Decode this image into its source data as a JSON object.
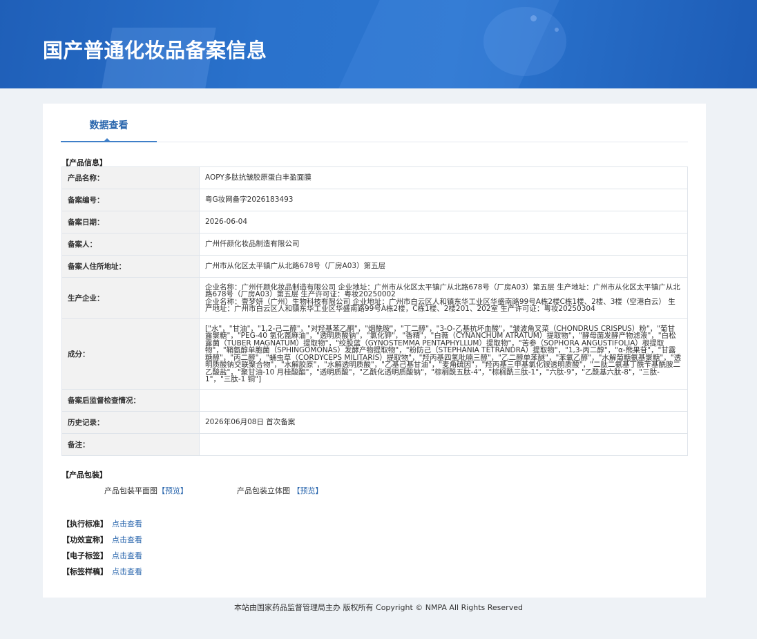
{
  "banner": {
    "title": "国产普通化妆品备案信息"
  },
  "tabs": [
    {
      "label": "数据查看"
    }
  ],
  "sections": {
    "product_info": "【产品信息】",
    "package": "【产品包装】"
  },
  "product": {
    "rows": [
      {
        "key": "产品名称：",
        "value": "AOPY多肽抗皱胶原蛋白丰盈面膜"
      },
      {
        "key": "备案编号：",
        "value": "粤G妆网备字2026183493"
      },
      {
        "key": "备案日期：",
        "value": "2026-06-04"
      },
      {
        "key": "备案人：",
        "value": "广州仟颜化妆品制造有限公司"
      },
      {
        "key": "备案人住所地址：",
        "value": "广州市从化区太平镇广从北路678号（厂房A03）第五层"
      },
      {
        "key": "生产企业：",
        "value": "企业名称：广州仟颜化妆品制造有限公司 企业地址：广州市从化区太平镇广从北路678号（厂房A03）第五层 生产地址：广州市从化区太平镇广从北路678号（厂房A03）第五层 生产许可证：粤妆20250002\n企业名称：壹梦妍（广州）生物科技有限公司 企业地址：广州市白云区人和镇东华工业区华盛南路99号A栋2楼C栋1楼、2楼、3楼（空港白云） 生产地址：广州市白云区人和镇东华工业区华盛南路99号A栋2楼，C栋1楼、2楼201、202室 生产许可证：粤妆20250304"
      },
      {
        "key": "成分：",
        "value": "[\"水\"，\"甘油\"，\"1,2-己二醇\"，\"对羟基苯乙酮\"，\"烟酰胺\"，\"丁二醇\"，\"3-O-乙基抗坏血酸\"，\"皱波角叉菜（CHONDRUS CRISPUS）粉\"，\"葡甘露聚糖\"，\"PEG-40 氢化蓖麻油\"，\"透明质酸钠\"，\"氯化钾\"，\"香精\"，\"白薇（CYNANCHUM ATRATUM）提取物\"，\"酵母菌发酵产物滤液\"，\"白松露菌（TUBER MAGNATUM）提取物\"，\"绞股蓝（GYNOSTEMMA PENTAPHYLLUM）提取物\"，\"苦参（SOPHORA ANGUSTIFOLIA）根提取物\"，\"鞘氨醇单胞菌（SPHINGOMONAS）发酵产物提取物\"，\"粉防己（STEPHANIA TETRANDRA）提取物\"，\"1,3-丙二醇\"，\"α-熊果苷\"，\"甘露糖醇\"，\"丙二醇\"，\"蛹虫草（CORDYCEPS MILITARIS）提取物\"，\"羟丙基四氢吡喃三醇\"，\"乙二醇单苯醚\"，\"苯氧乙醇\"，\"水解葡糖氨基聚糖\"，\"透明质酸钠交联聚合物\"，\"水解胶原\"，\"水解透明质酸\"，\"乙基己基甘油\"，\"麦角硫因\"，\"羟丙基三甲基氯化铵透明质酸\"，\"二肽二氨基丁酰苄基酰胺二乙酸盐\"，\"聚甘油-10 月桂酸酯\"，\"透明质酸\"，\"乙酰化透明质酸钠\"，\"棕榈酰五肽-4\"，\"棕榈酰三肽-1\"，\"六肽-9\"，\"乙酰基六肽-8\"，\"三肽-1\"，\"三肽-1 铜\"]"
      },
      {
        "key": "备案后监督检查情况：",
        "value": ""
      },
      {
        "key": "历史记录：",
        "value": "2026年06月08日 首次备案"
      },
      {
        "key": "备注：",
        "value": ""
      }
    ]
  },
  "package": {
    "flat": {
      "label": "产品包装平面图",
      "link": "【预览】"
    },
    "solid": {
      "label": "产品包装立体图",
      "link": "【预览】"
    }
  },
  "links": [
    {
      "label": "【执行标准】",
      "link": "点击查看"
    },
    {
      "label": "【功效宣称】",
      "link": "点击查看"
    },
    {
      "label": "【电子标签】",
      "link": "点击查看"
    },
    {
      "label": "【标签样稿】",
      "link": "点击查看"
    }
  ],
  "footer": {
    "text": "本站由国家药品监督管理局主办 版权所有 Copyright © NMPA All Rights Reserved"
  }
}
